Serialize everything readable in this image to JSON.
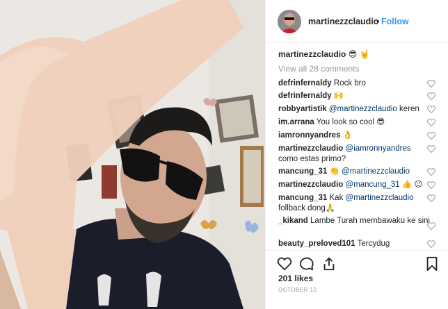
{
  "post": {
    "username": "martinezzclaudio",
    "separator": "•",
    "follow_label": "Follow",
    "caption": {
      "username": "martinezzclaudio",
      "text": "😎 🤘"
    },
    "view_all_comments": "View all 28 comments",
    "comments": [
      {
        "username": "defrinfernaldy",
        "text": "Rock bro"
      },
      {
        "username": "defrinfernaldy",
        "text": "🙌"
      },
      {
        "username": "robbyartistik",
        "mention": "@martinezzclaudio",
        "text": "keren"
      },
      {
        "username": "im.arrana",
        "text": "You look so cool 😎"
      },
      {
        "username": "iamronnyandres",
        "text": "👌"
      },
      {
        "username": "martinezzclaudio",
        "mention": "@iamronnyandres",
        "text": "como estas primo?"
      },
      {
        "username": "mancung_31",
        "pre": "👏",
        "mention": "@martinezzclaudio",
        "text": ""
      },
      {
        "username": "martinezzclaudio",
        "mention": "@mancung_31",
        "text": "👍 😉"
      },
      {
        "username": "mancung_31",
        "pre": "Kak",
        "mention": "@martinezzclaudio",
        "text": "follback dong🙏"
      },
      {
        "username": "_kikand",
        "text": "Lambe Turah membawaku ke sini"
      },
      {
        "username": "beauty_preloved101",
        "text": "Tercydug"
      }
    ],
    "likes": "201 likes",
    "date": "OCTOBER 12"
  },
  "icons": {
    "like": "heart-icon",
    "comment": "comment-bubble-icon",
    "share": "share-icon",
    "save": "bookmark-icon",
    "comment_like": "heart-icon"
  },
  "colors": {
    "link": "#3897f0",
    "muted": "#999999",
    "text": "#262626",
    "divider": "#efefef"
  }
}
